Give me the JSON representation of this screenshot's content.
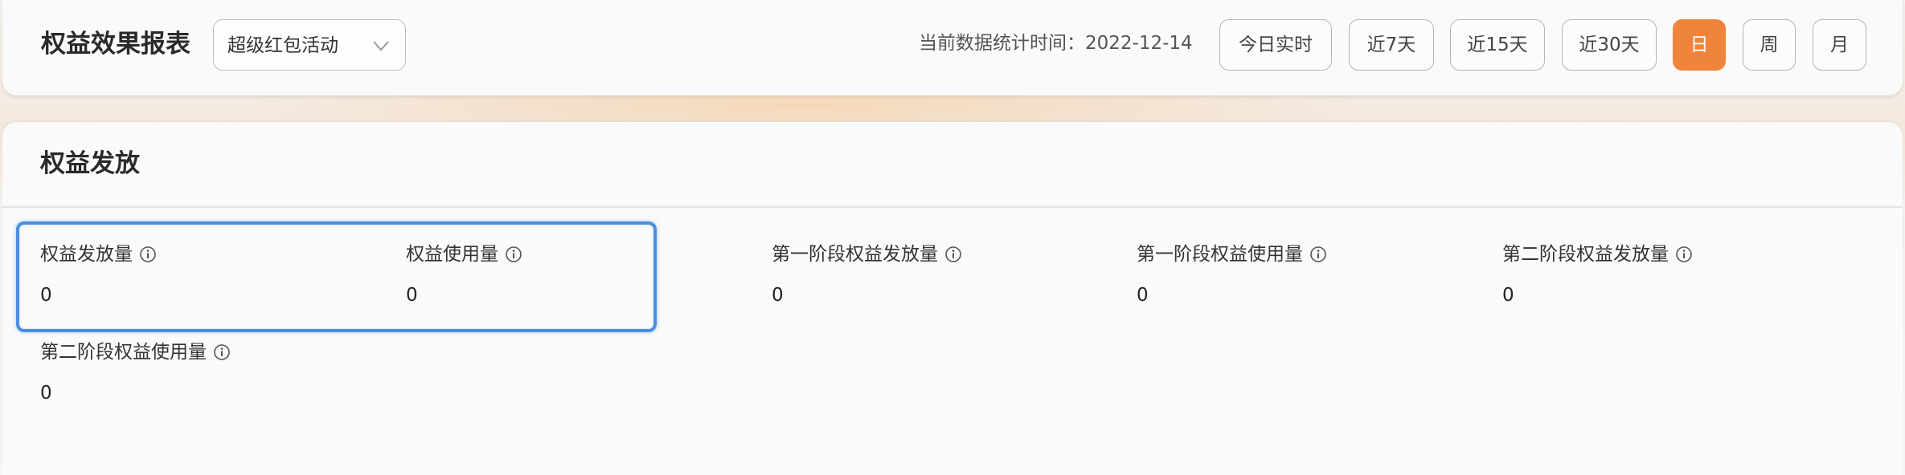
{
  "header": {
    "title": "权益效果报表",
    "activity_select": {
      "value": "超级红包活动"
    },
    "stat_time_label": "当前数据统计时间：2022-12-14",
    "range_buttons": [
      {
        "label": "今日实时"
      },
      {
        "label": "近7天"
      },
      {
        "label": "近15天"
      },
      {
        "label": "近30天"
      }
    ],
    "granularity_buttons": [
      {
        "label": "日",
        "active": true
      },
      {
        "label": "周",
        "active": false
      },
      {
        "label": "月",
        "active": false
      }
    ]
  },
  "section": {
    "title": "权益发放",
    "metrics": [
      {
        "label": "权益发放量",
        "value": "0"
      },
      {
        "label": "权益使用量",
        "value": "0"
      },
      {
        "label": "第一阶段权益发放量",
        "value": "0"
      },
      {
        "label": "第一阶段权益使用量",
        "value": "0"
      },
      {
        "label": "第二阶段权益发放量",
        "value": "0"
      },
      {
        "label": "第二阶段权益使用量",
        "value": "0"
      }
    ]
  },
  "colors": {
    "accent": "#f0843c",
    "highlight": "#4a8ee2"
  },
  "icons": {
    "dropdown": "chevron-down-icon",
    "metric_info": "info-icon"
  }
}
